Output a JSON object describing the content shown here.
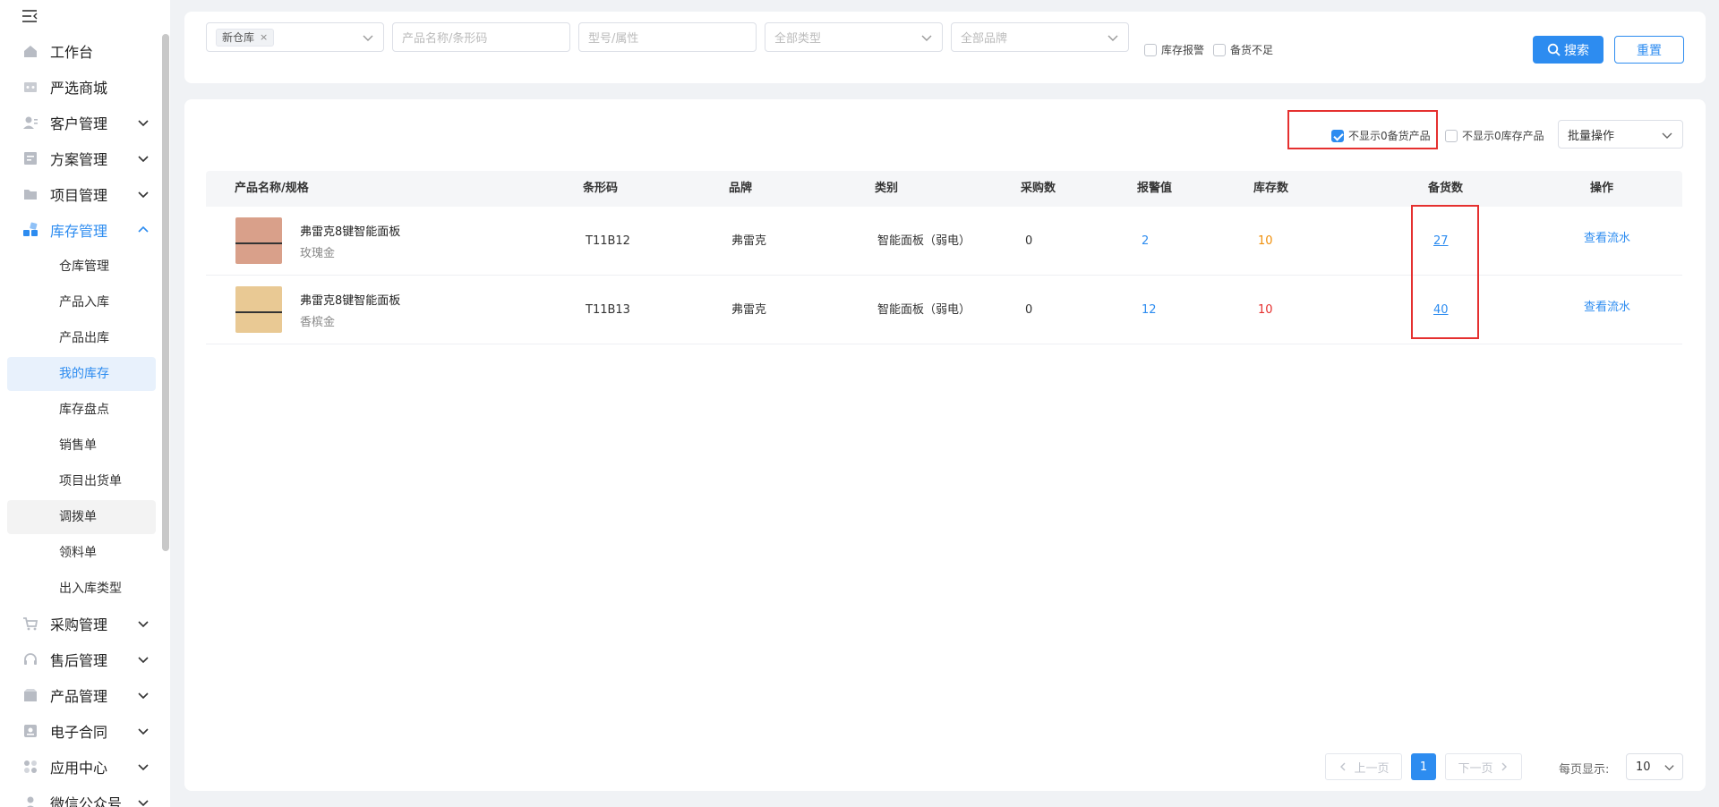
{
  "sidebar": {
    "menu": [
      {
        "label": "工作台",
        "icon": "home-icon",
        "expandable": false
      },
      {
        "label": "严选商城",
        "icon": "shop-icon",
        "expandable": false
      },
      {
        "label": "客户管理",
        "icon": "customer-icon",
        "expandable": true
      },
      {
        "label": "方案管理",
        "icon": "scheme-icon",
        "expandable": true
      },
      {
        "label": "项目管理",
        "icon": "folder-icon",
        "expandable": true
      },
      {
        "label": "库存管理",
        "icon": "inventory-icon",
        "expandable": true,
        "expanded": true
      },
      {
        "label": "采购管理",
        "icon": "cart-icon",
        "expandable": true
      },
      {
        "label": "售后管理",
        "icon": "headset-icon",
        "expandable": true
      },
      {
        "label": "产品管理",
        "icon": "box-icon",
        "expandable": true
      },
      {
        "label": "电子合同",
        "icon": "contract-icon",
        "expandable": true
      },
      {
        "label": "应用中心",
        "icon": "apps-icon",
        "expandable": true
      },
      {
        "label": "微信公众号",
        "icon": "wechat-icon",
        "expandable": true
      }
    ],
    "submenu": [
      "仓库管理",
      "产品入库",
      "产品出库",
      "我的库存",
      "库存盘点",
      "销售单",
      "项目出货单",
      "调拨单",
      "领料单",
      "出入库类型"
    ],
    "selected_submenu": "我的库存"
  },
  "filters": {
    "warehouse_tag": "新仓库",
    "product_placeholder": "产品名称/条形码",
    "model_placeholder": "型号/属性",
    "type_placeholder": "全部类型",
    "brand_placeholder": "全部品牌",
    "stock_alarm_label": "库存报警",
    "stock_short_label": "备货不足",
    "search_label": "搜索",
    "reset_label": "重置"
  },
  "toolbar": {
    "hide_zero_stockup_label": "不显示0备货产品",
    "hide_zero_stockup_checked": true,
    "hide_zero_inventory_label": "不显示0库存产品",
    "hide_zero_inventory_checked": false,
    "bulk_label": "批量操作"
  },
  "table": {
    "headers": [
      "产品名称/规格",
      "条形码",
      "品牌",
      "类别",
      "采购数",
      "报警值",
      "库存数",
      "备货数",
      "操作"
    ],
    "rows": [
      {
        "name": "弗雷克8键智能面板",
        "spec": "玫瑰金",
        "barcode": "T11B12",
        "brand": "弗雷克",
        "category": "智能面板（弱电）",
        "purchase": "0",
        "alarm": "2",
        "stock": "10",
        "stockup": "27",
        "action": "查看流水",
        "thumb_color": "#d9a08a"
      },
      {
        "name": "弗雷克8键智能面板",
        "spec": "香槟金",
        "barcode": "T11B13",
        "brand": "弗雷克",
        "category": "智能面板（弱电）",
        "purchase": "0",
        "alarm": "12",
        "stock": "10",
        "stockup": "40",
        "action": "查看流水",
        "thumb_color": "#e9c994"
      }
    ]
  },
  "pagination": {
    "prev_label": "上一页",
    "current_page": "1",
    "next_label": "下一页",
    "per_page_label": "每页显示:",
    "per_page_value": "10"
  },
  "colors": {
    "accent": "#2d8cf0",
    "alert_red": "#e5302f",
    "warn_orange": "#f0900c"
  }
}
